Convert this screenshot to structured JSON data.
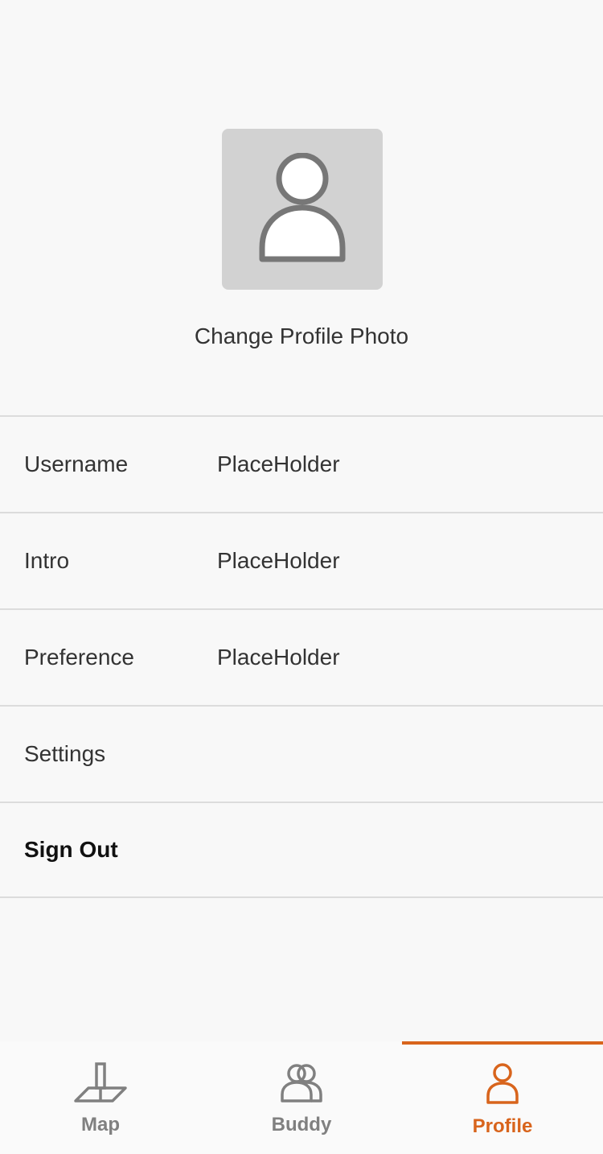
{
  "profile": {
    "change_photo_label": "Change Profile Photo",
    "avatar_icon": "person-placeholder-icon"
  },
  "fields": [
    {
      "label": "Username",
      "value": "PlaceHolder"
    },
    {
      "label": "Intro",
      "value": "PlaceHolder"
    },
    {
      "label": "Preference",
      "value": "PlaceHolder"
    },
    {
      "label": "Settings",
      "value": ""
    },
    {
      "label": "Sign Out",
      "value": ""
    }
  ],
  "tabs": [
    {
      "label": "Map",
      "icon": "map-pin-icon",
      "active": false
    },
    {
      "label": "Buddy",
      "icon": "buddy-icon",
      "active": false
    },
    {
      "label": "Profile",
      "icon": "profile-icon",
      "active": true
    }
  ],
  "colors": {
    "accent": "#d8641c",
    "inactive_tab": "#808080",
    "avatar_bg": "#d2d2d2",
    "divider": "#dcdcdc",
    "background": "#f8f8f8"
  }
}
